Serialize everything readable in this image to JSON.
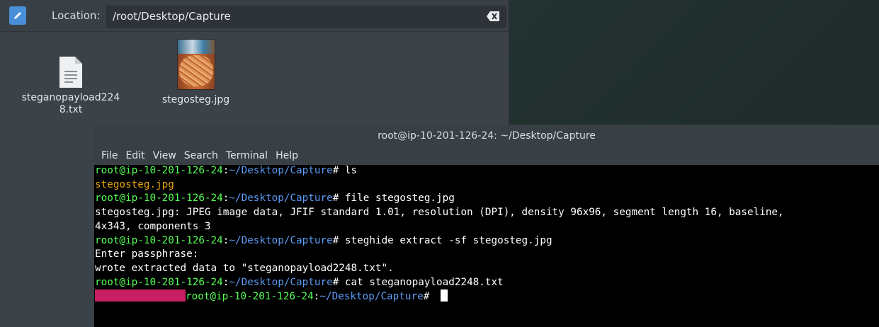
{
  "file_manager": {
    "location_label": "Location:",
    "location_value": "/root/Desktop/Capture",
    "files": [
      {
        "name": "steganopayload2248.txt",
        "line1": "steganopayload224",
        "line2": "8.txt",
        "icon": "text-file-icon"
      },
      {
        "name": "stegosteg.jpg",
        "icon": "image-thumbnail"
      }
    ]
  },
  "terminal": {
    "title": "root@ip-10-201-126-24: ~/Desktop/Capture",
    "menu": [
      "File",
      "Edit",
      "View",
      "Search",
      "Terminal",
      "Help"
    ],
    "prompt_user": "root@ip-10-201-126-24",
    "prompt_path": "~/Desktop/Capture",
    "lines": [
      {
        "kind": "prompt",
        "cmd": "ls"
      },
      {
        "kind": "output-orange",
        "text": "stegosteg.jpg"
      },
      {
        "kind": "prompt",
        "cmd": "file stegosteg.jpg"
      },
      {
        "kind": "output",
        "text": "stegosteg.jpg: JPEG image data, JFIF standard 1.01, resolution (DPI), density 96x96, segment length 16, baseline,"
      },
      {
        "kind": "output",
        "text": "4x343, components 3"
      },
      {
        "kind": "prompt",
        "cmd": "steghide extract -sf stegosteg.jpg"
      },
      {
        "kind": "output",
        "text": "Enter passphrase:"
      },
      {
        "kind": "output",
        "text": "wrote extracted data to \"steganopayload2248.txt\"."
      },
      {
        "kind": "prompt",
        "cmd": "cat steganopayload2248.txt"
      },
      {
        "kind": "redacted-prompt",
        "cmd": ""
      }
    ]
  },
  "colors": {
    "prompt_user": "#55ff55",
    "prompt_path": "#5c9cf5",
    "redaction": "#c81e62",
    "jpg_filename": "#e5a50a",
    "edit_button": "#4a90d9"
  }
}
